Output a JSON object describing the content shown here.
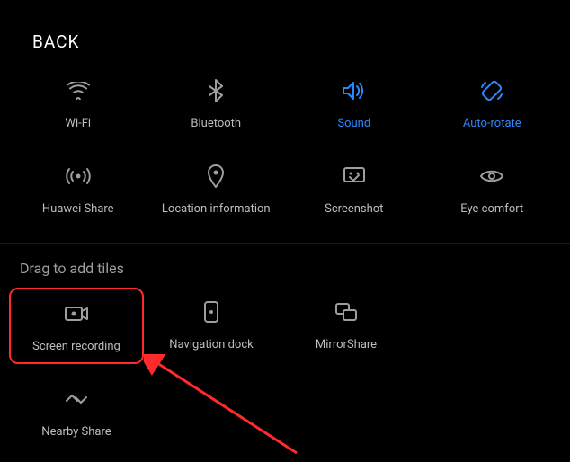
{
  "header": {
    "back": "BACK"
  },
  "tiles_active": [
    {
      "label": "Wi-Fi",
      "icon": "wifi",
      "active": false
    },
    {
      "label": "Bluetooth",
      "icon": "bluetooth",
      "active": false
    },
    {
      "label": "Sound",
      "icon": "sound",
      "active": true
    },
    {
      "label": "Auto-rotate",
      "icon": "autorotate",
      "active": true
    },
    {
      "label": "Huawei Share",
      "icon": "huaweishare",
      "active": false
    },
    {
      "label": "Location information",
      "icon": "location",
      "active": false
    },
    {
      "label": "Screenshot",
      "icon": "screenshot",
      "active": false
    },
    {
      "label": "Eye comfort",
      "icon": "eye",
      "active": false
    }
  ],
  "section_title": "Drag to add tiles",
  "tiles_drag": [
    {
      "label": "Screen recording",
      "icon": "screenrec",
      "highlight": true
    },
    {
      "label": "Navigation dock",
      "icon": "navdock",
      "highlight": false
    },
    {
      "label": "MirrorShare",
      "icon": "mirrorshare",
      "highlight": false
    },
    {
      "label": "Nearby Share",
      "icon": "nearby",
      "highlight": false
    }
  ],
  "colors": {
    "active": "#2b89ff",
    "inactive": "#9e9e9e"
  }
}
